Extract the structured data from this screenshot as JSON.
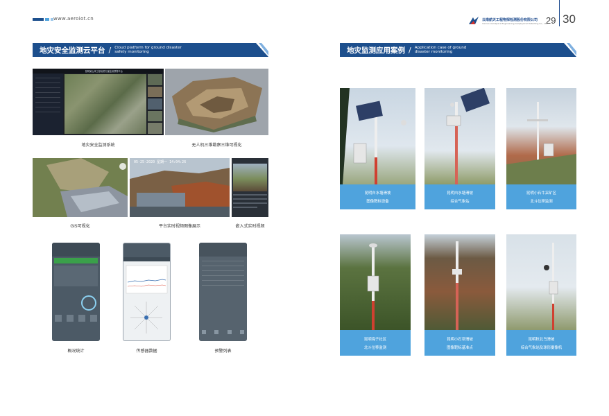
{
  "header": {
    "website": "www.aeroiot.cn",
    "company_cn": "云南航天工程物探检测股份有限公司",
    "company_en": "Yunnan Aerospace Engineering Geophysical Detecting Co., Ltd.",
    "page_left": "29",
    "page_right": "30"
  },
  "left": {
    "section_cn": "地灾安全监测云平台",
    "section_en_1": "Cloud platform for ground disaster",
    "section_en_2": "safety monitoring",
    "screen_title": "昆明某山体工程地质灾害监测预警平台",
    "video_timestamp": "05-25-2020 星期一 14:04:26",
    "captions": {
      "system": "地灾安全监测系统",
      "uav3d": "无人机三维勘察三维可视化",
      "gis": "GIS可视化",
      "video": "平台实时视频图像展示",
      "embedded": "嵌入式实时视频",
      "overview": "概况统计",
      "sensor": "传感器数据",
      "alarm": "预警列表"
    }
  },
  "right": {
    "section_cn": "地灾监测应用案例",
    "section_en_1": "Application case of ground",
    "section_en_2": "disaster monitoring",
    "cases": [
      {
        "line1": "昆明白水塘滑坡",
        "line2": "图像靶标设备"
      },
      {
        "line1": "昆明白水塘滑坡",
        "line2": "综合气象站"
      },
      {
        "line1": "昆明小石牛采矿区",
        "line2": "北斗位移监测"
      },
      {
        "line1": "昆明海子社区",
        "line2": "北斗位移监测"
      },
      {
        "line1": "昆明小石坝滑坡",
        "line2": "图像靶标基准点"
      },
      {
        "line1": "昆明秋北乌滑坡",
        "line2": "综合气象站及球形摄像机"
      }
    ]
  },
  "colors": {
    "bar_blue": "#1d4f8d",
    "label_blue": "#4fa3dd",
    "accent_light": "#7fb0e0"
  },
  "icons": [
    "company-logo-icon",
    "logo-stripes-icon",
    "bar-corner-icon"
  ]
}
